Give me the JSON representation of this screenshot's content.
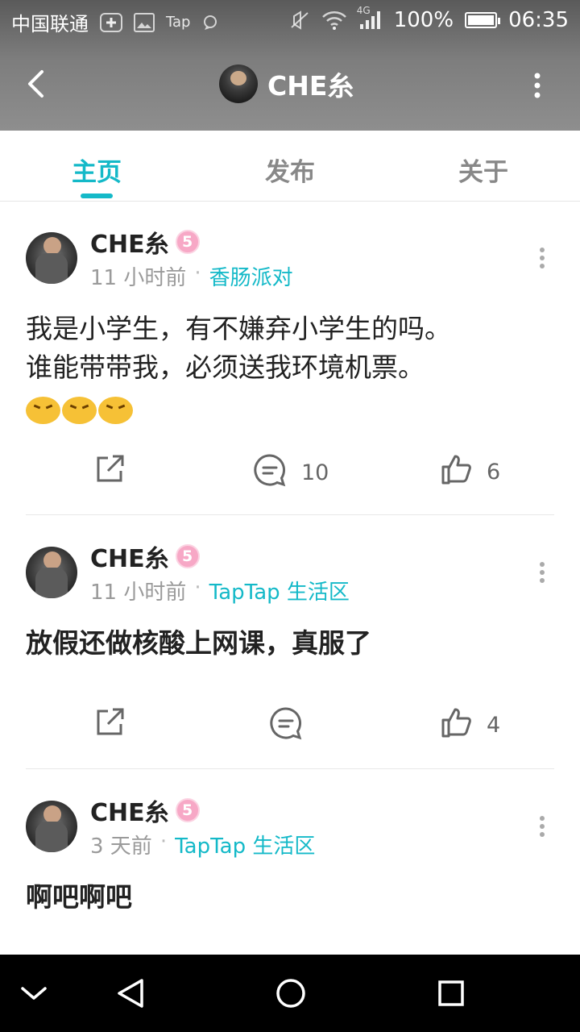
{
  "status_bar": {
    "carrier": "中国联通",
    "app_indicator": "Tap",
    "network": "4G",
    "battery": "100%",
    "time": "06:35",
    "icons": [
      "plus-icon",
      "image-icon",
      "tap-icon",
      "chat-icon",
      "mute-icon",
      "wifi-icon",
      "signal-icon",
      "battery-icon"
    ]
  },
  "header": {
    "title": "CHE糸",
    "back_icon": "chevron-left-icon",
    "more_icon": "more-vertical-icon"
  },
  "tabs": [
    {
      "label": "主页",
      "active": true
    },
    {
      "label": "发布",
      "active": false
    },
    {
      "label": "关于",
      "active": false
    }
  ],
  "accent_color": "#14b9c8",
  "posts": [
    {
      "author": "CHE糸",
      "badge": "5",
      "time": "11 小时前",
      "separator": "·",
      "forum": "香肠派对",
      "content_lines": [
        "我是小学生，有不嫌弃小学生的吗。",
        "谁能带带我，必须送我环境机票。"
      ],
      "emojis": [
        "angry-emoji",
        "angry-emoji",
        "angry-emoji"
      ],
      "comments": "10",
      "likes": "6"
    },
    {
      "author": "CHE糸",
      "badge": "5",
      "time": "11 小时前",
      "separator": "·",
      "forum": "TapTap 生活区",
      "content": "放假还做核酸上网课，真服了",
      "comments": "",
      "likes": "4"
    },
    {
      "author": "CHE糸",
      "badge": "5",
      "time": "3 天前",
      "separator": "·",
      "forum": "TapTap 生活区",
      "content": "啊吧啊吧"
    }
  ],
  "nav_bar": {
    "icons": [
      "collapse-icon",
      "back-triangle-icon",
      "home-circle-icon",
      "recents-square-icon"
    ]
  }
}
